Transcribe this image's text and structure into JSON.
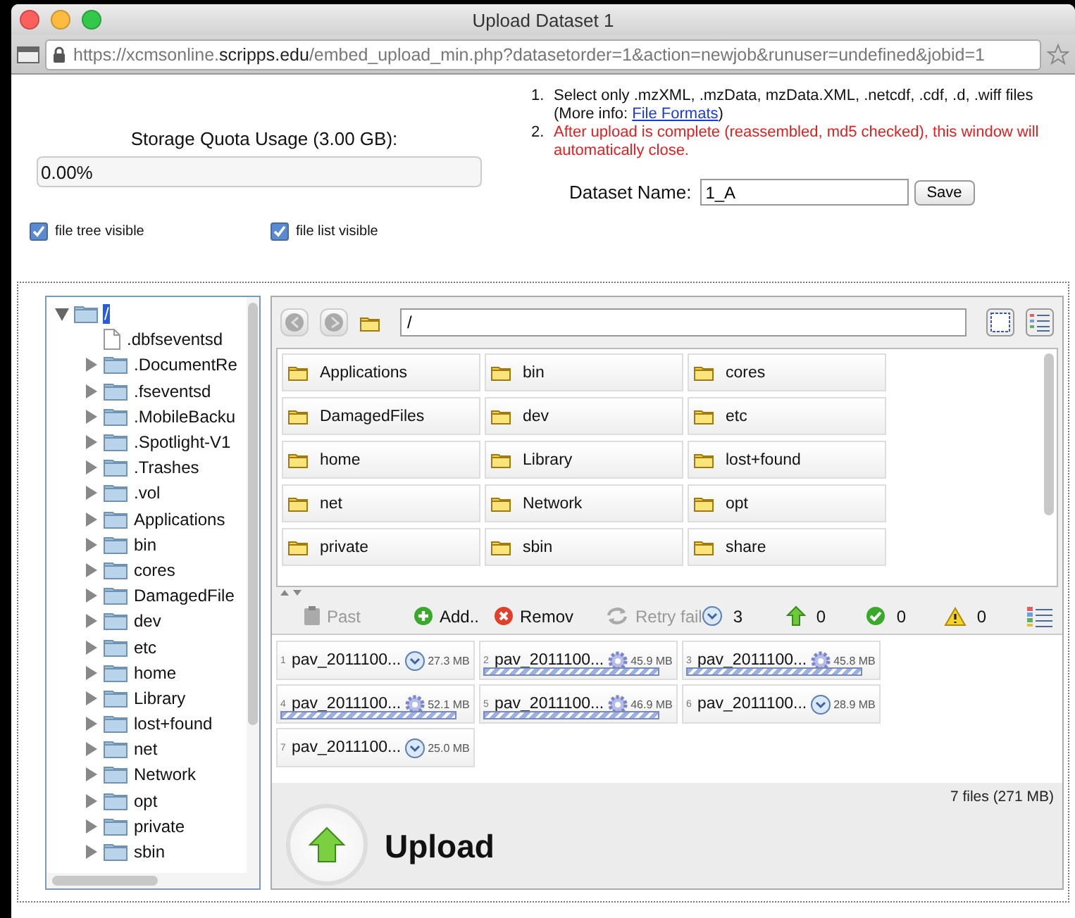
{
  "window": {
    "title": "Upload Dataset 1",
    "url": "https://xcmsonline.**scripps.edu**/embed_upload_min.php?datasetorder=1&action=newjob&runuser=undefined&jobid=1"
  },
  "quota": {
    "label": "Storage Quota Usage (3.00 GB):",
    "level": 0,
    "reading": "0.00%"
  },
  "options": [
    {
      "label": "file tree visible",
      "checked": true
    },
    {
      "label": "file list visible",
      "checked": true
    }
  ],
  "instructions": [
    {
      "kind": "note",
      "marker": "1.",
      "text": "Select only .mzXML, .mzData, mzData.XML, .netcdf, .cdf, .d, .wiff files",
      "note_prefix": "(More info: ",
      "link": "File Formats",
      "note_suffix": ")"
    },
    {
      "kind": "warning",
      "marker": "2.",
      "text": "After upload is complete (reassembled, md5 checked), this window will automatically close."
    }
  ],
  "dataset": {
    "label": "Dataset Name:",
    "value": "1_A",
    "button": "Save"
  },
  "tree": {
    "items": [
      {
        "label": "/",
        "kind": "folder",
        "expanded": true,
        "selected": true,
        "children": [
          {
            "label": ".dbfseventsd",
            "kind": "file",
            "selected": false
          },
          {
            "label": ".DocumentRe",
            "kind": "folder",
            "expanded": false,
            "selected": false
          },
          {
            "label": ".fseventsd",
            "kind": "folder",
            "expanded": false,
            "selected": false
          },
          {
            "label": ".MobileBacku",
            "kind": "folder",
            "expanded": false,
            "selected": false
          },
          {
            "label": ".Spotlight-V1",
            "kind": "folder",
            "expanded": false,
            "selected": false
          },
          {
            "label": ".Trashes",
            "kind": "folder",
            "expanded": false,
            "selected": false
          },
          {
            "label": ".vol",
            "kind": "folder",
            "expanded": false,
            "selected": false
          },
          {
            "label": "Applications",
            "kind": "folder",
            "expanded": false,
            "selected": false
          },
          {
            "label": "bin",
            "kind": "folder",
            "expanded": false,
            "selected": false
          },
          {
            "label": "cores",
            "kind": "folder",
            "expanded": false,
            "selected": false
          },
          {
            "label": "DamagedFile",
            "kind": "folder",
            "expanded": false,
            "selected": false
          },
          {
            "label": "dev",
            "kind": "folder",
            "expanded": false,
            "selected": false
          },
          {
            "label": "etc",
            "kind": "folder",
            "expanded": false,
            "selected": false
          },
          {
            "label": "home",
            "kind": "folder",
            "expanded": false,
            "selected": false
          },
          {
            "label": "Library",
            "kind": "folder",
            "expanded": false,
            "selected": false
          },
          {
            "label": "lost+found",
            "kind": "folder",
            "expanded": false,
            "selected": false
          },
          {
            "label": "net",
            "kind": "folder",
            "expanded": false,
            "selected": false
          },
          {
            "label": "Network",
            "kind": "folder",
            "expanded": false,
            "selected": false
          },
          {
            "label": "opt",
            "kind": "folder",
            "expanded": false,
            "selected": false
          },
          {
            "label": "private",
            "kind": "folder",
            "expanded": false,
            "selected": false
          },
          {
            "label": "sbin",
            "kind": "folder",
            "expanded": false,
            "selected": false
          }
        ]
      }
    ]
  },
  "browser": {
    "back": {
      "disabled": true
    },
    "forward": {
      "disabled": true
    },
    "path": "/",
    "folders": [
      "Applications",
      "bin",
      "cores",
      "DamagedFiles",
      "dev",
      "etc",
      "home",
      "Library",
      "lost+found",
      "net",
      "Network",
      "opt",
      "private",
      "sbin",
      "share"
    ]
  },
  "queue": {
    "actions": [
      {
        "kind": "paste",
        "label": "Past",
        "disabled": true
      },
      {
        "kind": "add",
        "label": "Add..",
        "disabled": false
      },
      {
        "kind": "remove",
        "label": "Remov",
        "disabled": false
      },
      {
        "kind": "retry",
        "label": "Retry fail",
        "disabled": true
      }
    ],
    "counts": [
      {
        "kind": "waiting",
        "count": "3"
      },
      {
        "kind": "uploading",
        "count": "0"
      },
      {
        "kind": "done",
        "count": "0"
      },
      {
        "kind": "error",
        "count": "0"
      }
    ],
    "files": [
      {
        "number": "1",
        "name": "pav_2011100...",
        "kind": "waiting",
        "size": "27.3 MB"
      },
      {
        "number": "2",
        "name": "pav_2011100...",
        "kind": "processing",
        "size": "45.9 MB",
        "level": 1
      },
      {
        "number": "3",
        "name": "pav_2011100...",
        "kind": "processing",
        "size": "45.8 MB",
        "level": 1
      },
      {
        "number": "4",
        "name": "pav_2011100...",
        "kind": "processing",
        "size": "52.1 MB",
        "level": 1
      },
      {
        "number": "5",
        "name": "pav_2011100...",
        "kind": "processing",
        "size": "46.9 MB",
        "level": 1
      },
      {
        "number": "6",
        "name": "pav_2011100...",
        "kind": "waiting",
        "size": "28.9 MB"
      },
      {
        "number": "7",
        "name": "pav_2011100...",
        "kind": "waiting",
        "size": "25.0 MB"
      }
    ]
  },
  "upload": {
    "button": "Upload",
    "summary": "7 files (271 MB)"
  }
}
